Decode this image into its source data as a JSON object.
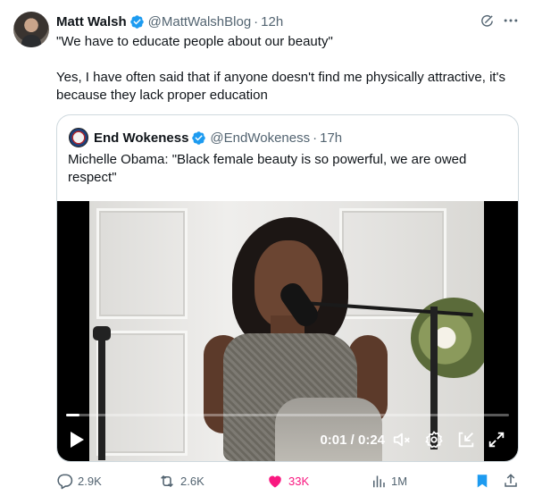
{
  "tweet": {
    "author_name": "Matt Walsh",
    "author_handle": "@MattWalshBlog",
    "separator": "·",
    "time": "12h",
    "text_line1": "\"We have to educate people about our beauty\"",
    "text_line2": "Yes, I have often said that if anyone doesn't find me physically attractive, it's because they lack proper education",
    "icons": {
      "verified": "verified-badge-icon",
      "grok": "grok-icon",
      "more": "more-options-icon"
    }
  },
  "quoted": {
    "author_name": "End Wokeness",
    "author_handle": "@EndWokeness",
    "separator": "·",
    "time": "17h",
    "text": "Michelle Obama: \"Black female beauty is so powerful, we are owed respect\""
  },
  "video": {
    "timecode": "0:01 / 0:24",
    "progress": 0.03,
    "icons": [
      "play-icon",
      "mute-icon",
      "settings-icon",
      "picture-in-picture-icon",
      "fullscreen-icon"
    ]
  },
  "actions": {
    "replies": "2.9K",
    "reposts": "2.6K",
    "likes": "33K",
    "views": "1M",
    "liked": true,
    "bookmarked": true
  },
  "colors": {
    "text": "#0f1419",
    "secondary": "#536471",
    "verified": "#1d9bf0",
    "like": "#f91880",
    "bookmark": "#1d9bf0",
    "border": "#cfd9de"
  }
}
